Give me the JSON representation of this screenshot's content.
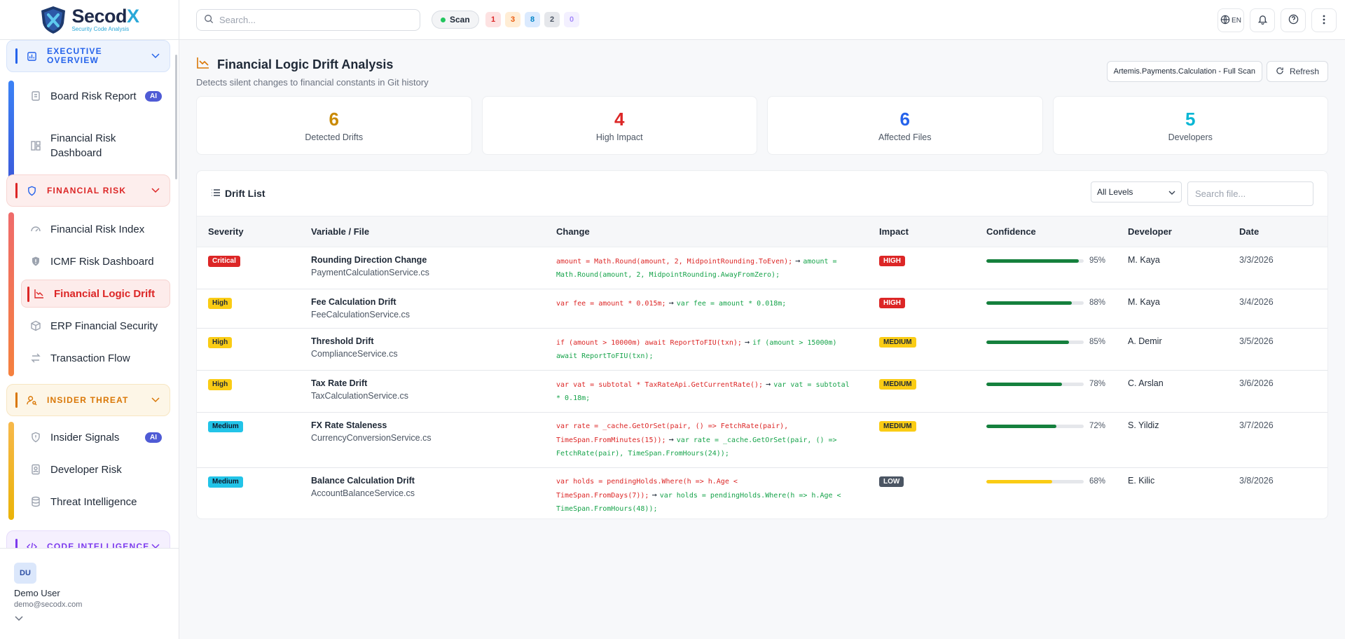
{
  "brand": {
    "name_main": "Secod",
    "name_x": "X",
    "tagline": "Security Code Analysis"
  },
  "sidebar": {
    "sections": [
      {
        "title": "EXECUTIVE OVERVIEW",
        "color": "#2563eb"
      },
      {
        "title": "FINANCIAL RISK",
        "color": "#dc2626"
      },
      {
        "title": "INSIDER THREAT",
        "color": "#d97706"
      },
      {
        "title": "CODE INTELLIGENCE",
        "color": "#7c3aed"
      }
    ],
    "items": [
      {
        "label": "Board Risk Report",
        "badge": "AI"
      },
      {
        "label": "Financial Risk Dashboard"
      },
      {
        "label": "Financial Risk Index"
      },
      {
        "label": "ICMF Risk Dashboard"
      },
      {
        "label": "Financial Logic Drift"
      },
      {
        "label": "ERP Financial Security"
      },
      {
        "label": "Transaction Flow"
      },
      {
        "label": "Insider Signals",
        "badge": "AI"
      },
      {
        "label": "Developer Risk"
      },
      {
        "label": "Threat Intelligence"
      }
    ]
  },
  "user": {
    "initials": "DU",
    "name": "Demo User",
    "email": "demo@secodx.com"
  },
  "topbar": {
    "search_placeholder": "Search...",
    "scan_label": "Scan",
    "counts": [
      {
        "value": "1",
        "color": "#dc2626",
        "bg": "#fde2e2"
      },
      {
        "value": "3",
        "color": "#ea580c",
        "bg": "#ffedd5"
      },
      {
        "value": "8",
        "color": "#0284c7",
        "bg": "#dbeafe"
      },
      {
        "value": "2",
        "color": "#4b5563",
        "bg": "#e5e7eb"
      },
      {
        "value": "0",
        "color": "#a78bfa",
        "bg": "#f3f0ff"
      }
    ],
    "lang": "EN"
  },
  "page": {
    "title": "Financial Logic Drift Analysis",
    "subtitle": "Detects silent changes to financial constants in Git history",
    "scope": "Artemis.Payments.Calculation - Full Scan",
    "refresh_label": "Refresh"
  },
  "stats": [
    {
      "value": "6",
      "label": "Detected Drifts",
      "color": "#ca8a04"
    },
    {
      "value": "4",
      "label": "High Impact",
      "color": "#dc2626"
    },
    {
      "value": "6",
      "label": "Affected Files",
      "color": "#2563eb"
    },
    {
      "value": "5",
      "label": "Developers",
      "color": "#06b6d4"
    }
  ],
  "drift_list": {
    "title": "Drift List",
    "level_filter": "All Levels",
    "file_search_placeholder": "Search file...",
    "columns": [
      "Severity",
      "Variable / File",
      "Change",
      "Impact",
      "Confidence",
      "Developer",
      "Date"
    ],
    "rows": [
      {
        "severity": "Critical",
        "sev_color": "#dc2626",
        "sev_text": "#ffffff",
        "name": "Rounding Direction Change",
        "file": "PaymentCalculationService.cs",
        "old": "amount = Math.Round(amount, 2, MidpointRounding.ToEven);",
        "new": "amount = Math.Round(amount, 2, MidpointRounding.AwayFromZero);",
        "impact": "HIGH",
        "impact_color": "#dc2626",
        "impact_text": "#ffffff",
        "confidence": 95,
        "conf_label": "95%",
        "conf_color": "#15803d",
        "developer": "M. Kaya",
        "date": "3/3/2026"
      },
      {
        "severity": "High",
        "sev_color": "#facc15",
        "sev_text": "#1f2937",
        "name": "Fee Calculation Drift",
        "file": "FeeCalculationService.cs",
        "old": "var fee = amount * 0.015m;",
        "new": "var fee = amount * 0.018m;",
        "impact": "HIGH",
        "impact_color": "#dc2626",
        "impact_text": "#ffffff",
        "confidence": 88,
        "conf_label": "88%",
        "conf_color": "#15803d",
        "developer": "M. Kaya",
        "date": "3/4/2026"
      },
      {
        "severity": "High",
        "sev_color": "#facc15",
        "sev_text": "#1f2937",
        "name": "Threshold Drift",
        "file": "ComplianceService.cs",
        "old": "if (amount > 10000m) await ReportToFIU(txn);",
        "new": "if (amount > 15000m) await ReportToFIU(txn);",
        "impact": "MEDIUM",
        "impact_color": "#facc15",
        "impact_text": "#1f2937",
        "confidence": 85,
        "conf_label": "85%",
        "conf_color": "#15803d",
        "developer": "A. Demir",
        "date": "3/5/2026"
      },
      {
        "severity": "High",
        "sev_color": "#facc15",
        "sev_text": "#1f2937",
        "name": "Tax Rate Drift",
        "file": "TaxCalculationService.cs",
        "old": "var vat = subtotal * TaxRateApi.GetCurrentRate();",
        "new": "var vat = subtotal * 0.18m;",
        "impact": "MEDIUM",
        "impact_color": "#facc15",
        "impact_text": "#1f2937",
        "confidence": 78,
        "conf_label": "78%",
        "conf_color": "#15803d",
        "developer": "C. Arslan",
        "date": "3/6/2026"
      },
      {
        "severity": "Medium",
        "sev_color": "#22c4e8",
        "sev_text": "#0f172a",
        "name": "FX Rate Staleness",
        "file": "CurrencyConversionService.cs",
        "old": "var rate = _cache.GetOrSet(pair, () => FetchRate(pair), TimeSpan.FromMinutes(15));",
        "new": "var rate = _cache.GetOrSet(pair, () => FetchRate(pair), TimeSpan.FromHours(24));",
        "impact": "MEDIUM",
        "impact_color": "#facc15",
        "impact_text": "#1f2937",
        "confidence": 72,
        "conf_label": "72%",
        "conf_color": "#15803d",
        "developer": "S. Yildiz",
        "date": "3/7/2026"
      },
      {
        "severity": "Medium",
        "sev_color": "#22c4e8",
        "sev_text": "#0f172a",
        "name": "Balance Calculation Drift",
        "file": "AccountBalanceService.cs",
        "old": "var holds = pendingHolds.Where(h => h.Age < TimeSpan.FromDays(7));",
        "new": "var holds = pendingHolds.Where(h => h.Age < TimeSpan.FromHours(48));",
        "impact": "LOW",
        "impact_color": "#4b5563",
        "impact_text": "#ffffff",
        "confidence": 68,
        "conf_label": "68%",
        "conf_color": "#facc15",
        "developer": "E. Kilic",
        "date": "3/8/2026"
      }
    ]
  }
}
